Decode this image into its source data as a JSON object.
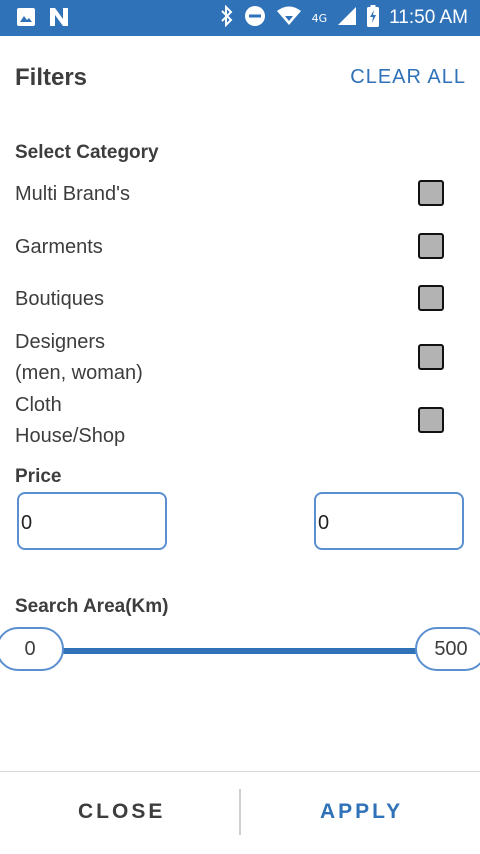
{
  "status_bar": {
    "time": "11:50 AM",
    "network_label": "4G",
    "left_icons": [
      "image-icon",
      "n-app-icon"
    ],
    "right_icons": [
      "bluetooth-icon",
      "dnd-icon",
      "wifi-icon",
      "signal-icon",
      "battery-charging-icon"
    ],
    "color": "#2f72b8"
  },
  "header": {
    "title": "Filters",
    "clear_all": "CLEAR ALL"
  },
  "category": {
    "label": "Select Category",
    "items": [
      {
        "line1": "Multi Brand's",
        "line2": "",
        "checked": false
      },
      {
        "line1": "Garments",
        "line2": "",
        "checked": false
      },
      {
        "line1": "Boutiques",
        "line2": "",
        "checked": false
      },
      {
        "line1": "Designers",
        "line2": "(men, woman)",
        "checked": false
      },
      {
        "line1": "Cloth",
        "line2": "House/Shop",
        "checked": false
      }
    ]
  },
  "price": {
    "label": "Price",
    "min_value": "0",
    "max_value": "0"
  },
  "search_area": {
    "label": "Search Area(Km)",
    "min": "0",
    "max": "500"
  },
  "footer": {
    "close": "CLOSE",
    "apply": "APPLY",
    "close_color": "#3d3d3d",
    "apply_color": "#2f72b8"
  }
}
